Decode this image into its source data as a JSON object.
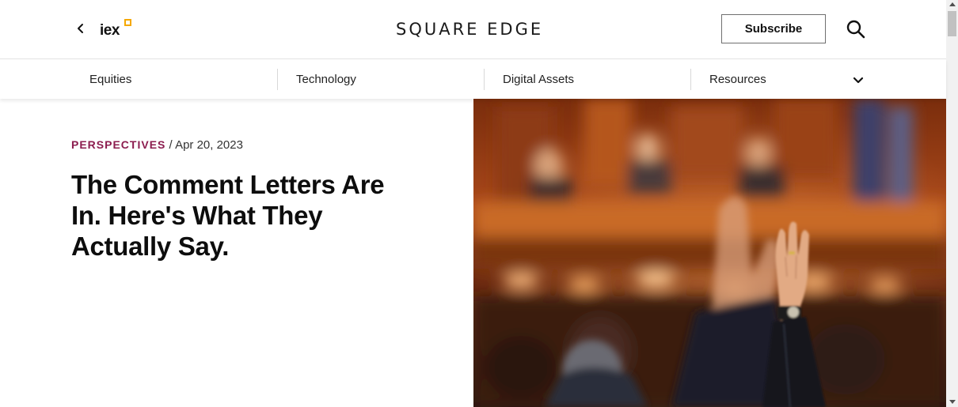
{
  "header": {
    "logo_text": "iex",
    "brand": "SQUARE EDGE",
    "subscribe_label": "Subscribe"
  },
  "icons": {
    "back": "chevron-left-icon",
    "search": "search-icon",
    "nav_more": "chevron-down-icon"
  },
  "nav": {
    "items": [
      {
        "label": "Equities"
      },
      {
        "label": "Technology"
      },
      {
        "label": "Digital Assets"
      },
      {
        "label": "Resources"
      }
    ]
  },
  "article": {
    "category": "PERSPECTIVES",
    "separator": "/",
    "date": "Apr 20, 2023",
    "title": "The Comment Letters Are In. Here's What They Actually Say."
  },
  "colors": {
    "category": "#8c1d4f",
    "logo_accent": "#f5a800",
    "text": "#111111"
  }
}
